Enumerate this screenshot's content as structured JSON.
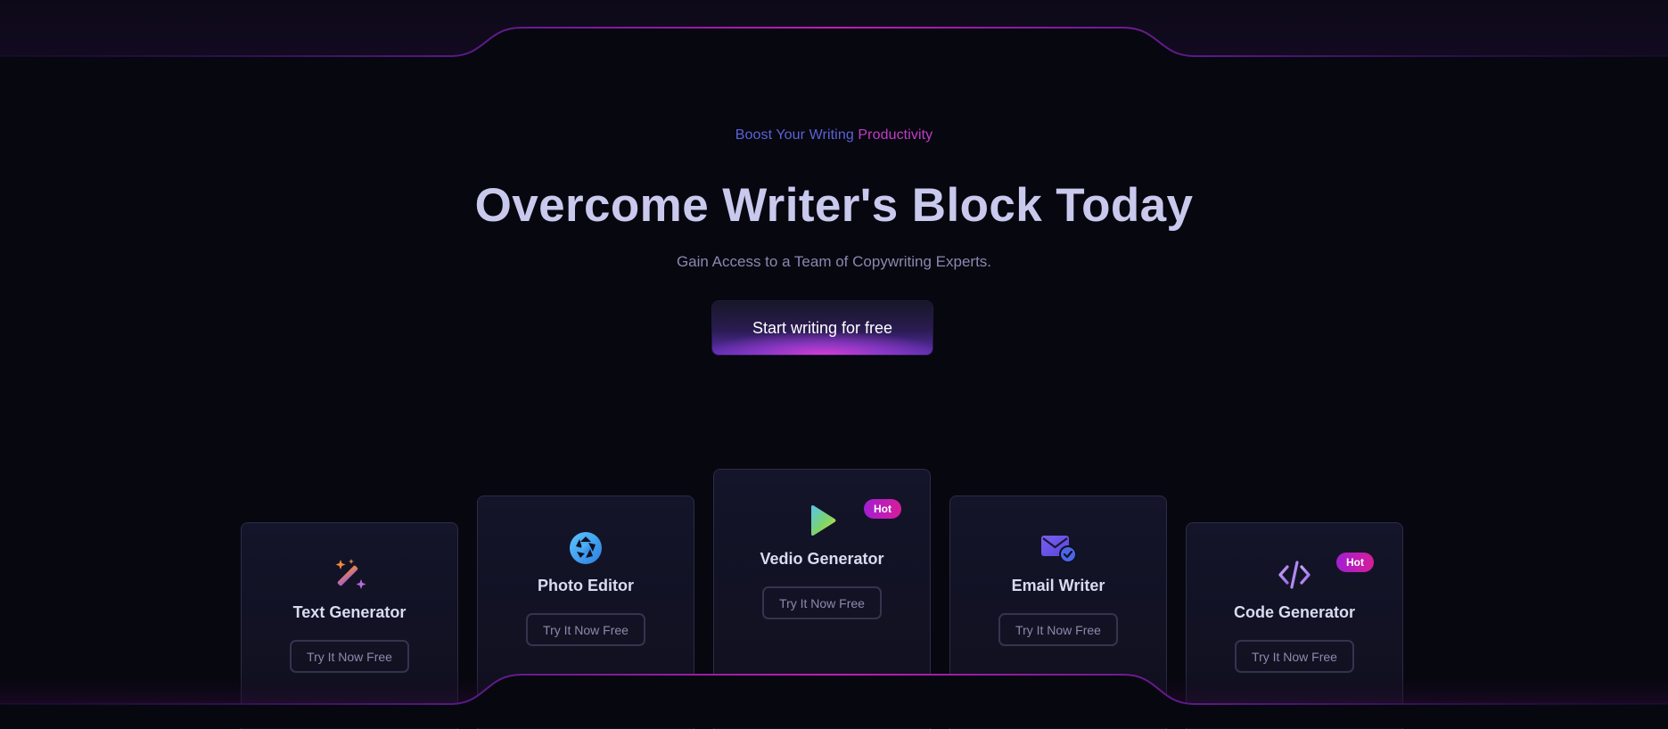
{
  "hero": {
    "eyebrow_part1": "Boost Your Writing ",
    "eyebrow_part2": "Productivity",
    "headline": "Overcome Writer's Block Today",
    "subhead": "Gain Access to a Team of Copywriting Experts.",
    "cta_label": "Start writing for free"
  },
  "cards": [
    {
      "title": "Text Generator",
      "icon": "magic-wand-icon",
      "button": "Try It Now Free",
      "badge": ""
    },
    {
      "title": "Photo Editor",
      "icon": "camera-aperture-icon",
      "button": "Try It Now Free",
      "badge": ""
    },
    {
      "title": "Vedio Generator",
      "icon": "play-icon",
      "button": "Try It Now Free",
      "badge": "Hot"
    },
    {
      "title": "Email Writer",
      "icon": "envelope-check-icon",
      "button": "Try It Now Free",
      "badge": ""
    },
    {
      "title": "Code Generator",
      "icon": "code-brackets-icon",
      "button": "Try It Now Free",
      "badge": "Hot"
    }
  ],
  "colors": {
    "background": "#07070f",
    "accent_pink": "#d83ed6",
    "accent_purple": "#6a3fd8",
    "headline": "#c9c9ee",
    "badge_gradient": [
      "#a21fd3",
      "#d61d9a"
    ]
  }
}
